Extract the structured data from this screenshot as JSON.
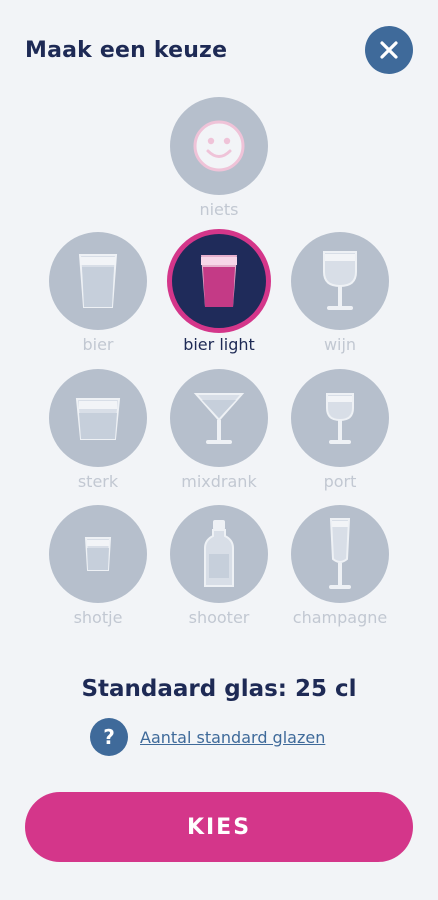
{
  "header": {
    "title": "Maak een keuze",
    "close_icon": "close-icon"
  },
  "options": [
    {
      "label": "niets",
      "icon": "smiley-icon"
    },
    {
      "label": "bier",
      "icon": "beer-glass-icon"
    },
    {
      "label": "bier light",
      "icon": "beer-glass-icon",
      "selected": true
    },
    {
      "label": "wijn",
      "icon": "wine-glass-icon"
    },
    {
      "label": "sterk",
      "icon": "tumbler-icon"
    },
    {
      "label": "mixdrank",
      "icon": "cocktail-glass-icon"
    },
    {
      "label": "port",
      "icon": "port-glass-icon"
    },
    {
      "label": "shotje",
      "icon": "shot-glass-icon"
    },
    {
      "label": "shooter",
      "icon": "bottle-icon"
    },
    {
      "label": "champagne",
      "icon": "champagne-flute-icon"
    }
  ],
  "standard_glass": "Standaard glas: 25 cl",
  "help": {
    "icon_text": "?",
    "link": "Aantal standard glazen"
  },
  "kies_button": "KIES",
  "colors": {
    "accent": "#d4368a",
    "navy": "#1e2a55",
    "blue": "#3f6a9a",
    "inactive": "#b6bfcc"
  }
}
